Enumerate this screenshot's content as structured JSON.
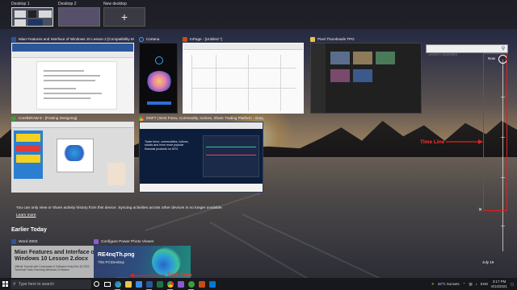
{
  "desktops": [
    {
      "label": "Desktop 1",
      "active": true
    },
    {
      "label": "Desktop 2",
      "active": false
    }
  ],
  "new_desktop": {
    "label": "New desktop",
    "icon": "plus-icon"
  },
  "windows": {
    "word": {
      "title": "Mian Features and Interface of Windows 10 Lesson 2 [Compatibility M...",
      "icon": "word-icon"
    },
    "cortana": {
      "title": "Cortana",
      "icon": "cortana-icon"
    },
    "infopage": {
      "title": "InPage - [Untitled *]",
      "icon": "inpage-icon"
    },
    "photos": {
      "title": "Pixel Thumbnails TPO",
      "icon": "photos-icon"
    },
    "corel": {
      "title": "CorelDRAW 9 - [Posting Designing]",
      "icon": "coreldraw-icon"
    },
    "msft": {
      "title": "MSFT | Best Forex, Commodity, Indices, Share Trading Platform - Goog...",
      "icon": "chrome-icon"
    }
  },
  "msft_text": "Trade forex, commodities, indices, stocks and even more popular financial products on MT4",
  "search": {
    "placeholder": "Search activities"
  },
  "timeline": {
    "now_label": "Now",
    "date_label": "July 16"
  },
  "annotations": {
    "time_line": "Time Line",
    "task_view": "Task View"
  },
  "notice": {
    "text": "You can only view or share activity history from this device. Syncing activities across other devices is no longer available.",
    "link": "Learn more"
  },
  "earlier": {
    "title": "Earlier Today",
    "word_card": {
      "app": "Word 2003",
      "title": "Mian Features and Interface of Windows 10 Lesson 2.docx",
      "detail": "Official Tutorial with Downloads & Software Help Dec 16 2021 Technical Tools Teaching Windows 10 Basics"
    },
    "photo_card": {
      "app": "Configure Power Photo Viewer",
      "title": "RE4nqTh.png",
      "detail": "This PC\\Desktop"
    }
  },
  "taskbar": {
    "search_placeholder": "Type here to search",
    "weather": "33°C  Sunsets",
    "lang": "ENG",
    "time": "3:17 PM",
    "date": "8/14/2021"
  },
  "colors": {
    "accent": "#2b579a",
    "annotation": "#e02020"
  }
}
